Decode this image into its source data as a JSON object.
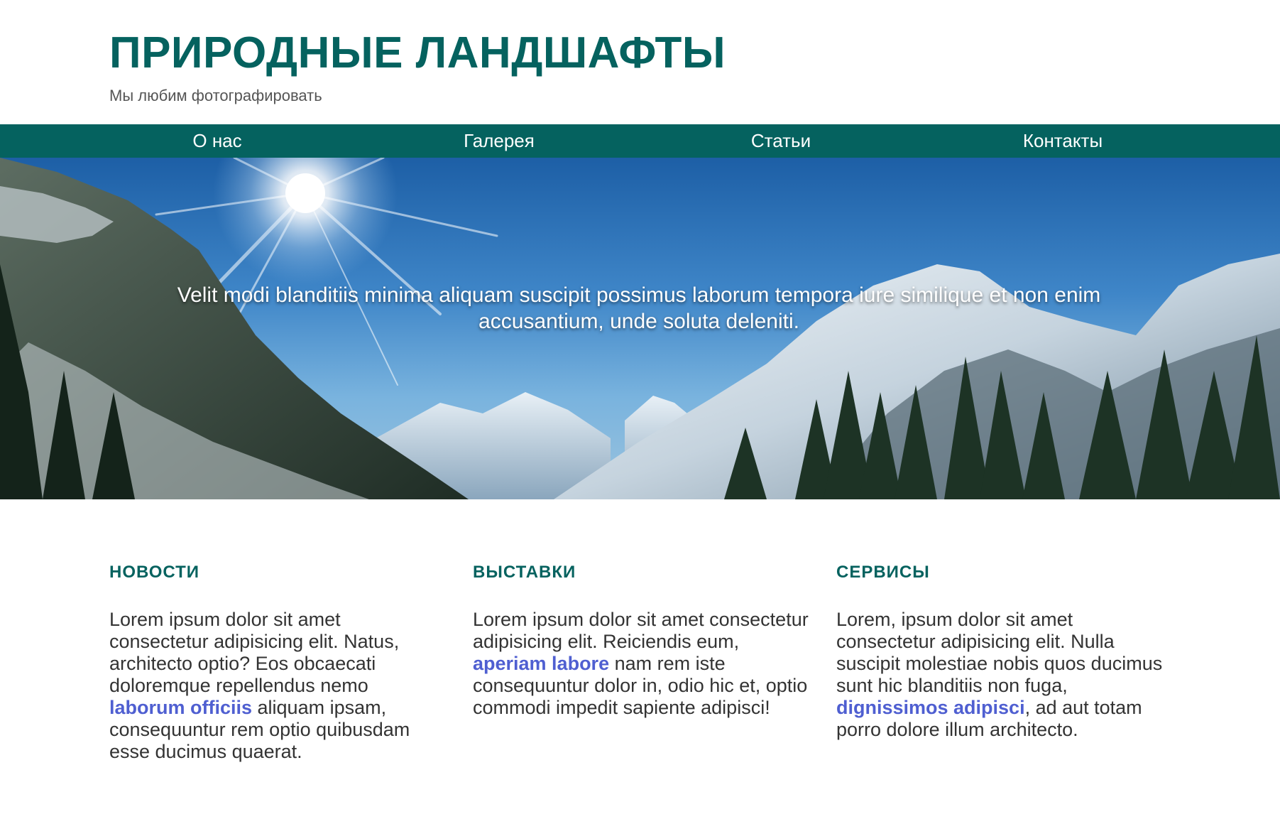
{
  "header": {
    "title": "ПРИРОДНЫЕ ЛАНДШАФТЫ",
    "subtitle": "Мы любим фотографировать"
  },
  "nav": {
    "items": [
      {
        "label": "О нас"
      },
      {
        "label": "Галерея"
      },
      {
        "label": "Статьи"
      },
      {
        "label": "Контакты"
      }
    ]
  },
  "hero": {
    "text": "Velit modi blanditiis minima aliquam suscipit possimus laborum tempora iure similique et non enim accusantium, unde soluta deleniti.",
    "image_icon": "mountain-landscape-icon"
  },
  "columns": [
    {
      "title": "НОВОСТИ",
      "text_before": "Lorem ipsum dolor sit amet consectetur adipisicing elit. Natus, architecto optio? Eos obcaecati doloremque repellendus nemo ",
      "link": "laborum officiis",
      "text_after": " aliquam ipsam, consequuntur rem optio quibusdam esse ducimus quaerat."
    },
    {
      "title": "ВЫСТАВКИ",
      "text_before": "Lorem ipsum dolor sit amet consectetur adipisicing elit. Reiciendis eum, ",
      "link": "aperiam labore",
      "text_after": " nam rem iste consequuntur dolor in, odio hic et, optio commodi impedit sapiente adipisci!"
    },
    {
      "title": "СЕРВИСЫ",
      "text_before": "Lorem, ipsum dolor sit amet consectetur adipisicing elit. Nulla suscipit molestiae nobis quos ducimus sunt hic blanditiis non fuga, ",
      "link": "dignissimos adipisci",
      "text_after": ", ad aut totam porro dolore illum architecto."
    }
  ],
  "colors": {
    "brand": "#05625f",
    "link": "#4f5fd1",
    "text": "#333333"
  }
}
